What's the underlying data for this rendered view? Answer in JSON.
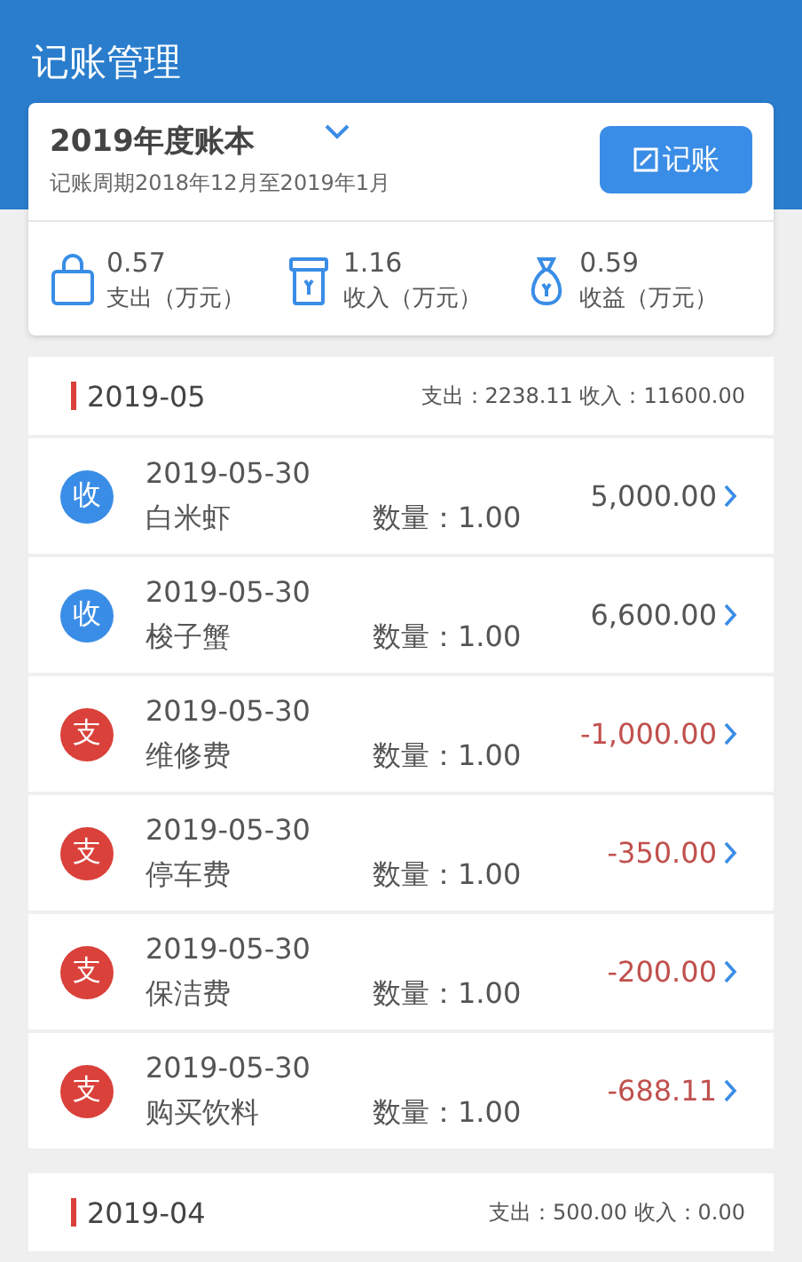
{
  "header": {
    "title": "记账管理"
  },
  "book": {
    "name": "2019年度账本",
    "period": "记账周期2018年12月至2019年1月",
    "add_button": "记账"
  },
  "stats": [
    {
      "kind": "expense",
      "value": "0.57",
      "label": "支出（万元）"
    },
    {
      "kind": "income",
      "value": "1.16",
      "label": "收入（万元）"
    },
    {
      "kind": "profit",
      "value": "0.59",
      "label": "收益（万元）"
    }
  ],
  "months": [
    {
      "month": "2019-05",
      "summary": "支出：2238.11 收入：11600.00",
      "entries": [
        {
          "kind": "income",
          "badge": "收",
          "date": "2019-05-30",
          "name": "白米虾",
          "quantity": "数量：1.00",
          "amount": "5,000.00"
        },
        {
          "kind": "income",
          "badge": "收",
          "date": "2019-05-30",
          "name": "梭子蟹",
          "quantity": "数量：1.00",
          "amount": "6,600.00"
        },
        {
          "kind": "expense",
          "badge": "支",
          "date": "2019-05-30",
          "name": "维修费",
          "quantity": "数量：1.00",
          "amount": "-1,000.00"
        },
        {
          "kind": "expense",
          "badge": "支",
          "date": "2019-05-30",
          "name": "停车费",
          "quantity": "数量：1.00",
          "amount": "-350.00"
        },
        {
          "kind": "expense",
          "badge": "支",
          "date": "2019-05-30",
          "name": "保洁费",
          "quantity": "数量：1.00",
          "amount": "-200.00"
        },
        {
          "kind": "expense",
          "badge": "支",
          "date": "2019-05-30",
          "name": "购买饮料",
          "quantity": "数量：1.00",
          "amount": "-688.11"
        }
      ]
    },
    {
      "month": "2019-04",
      "summary": "支出：500.00 收入：0.00"
    }
  ]
}
